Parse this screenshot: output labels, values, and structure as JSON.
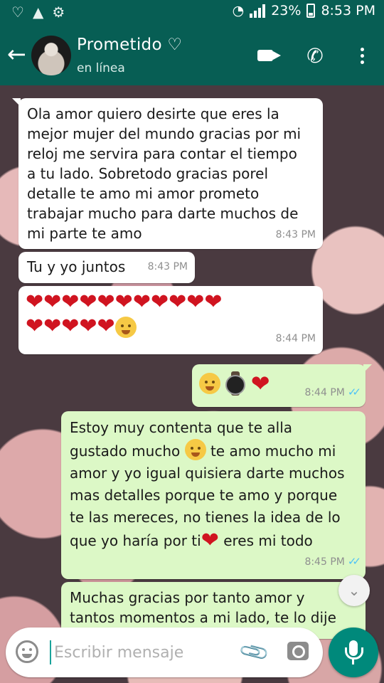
{
  "status_bar": {
    "battery": "23%",
    "time": "8:53 PM"
  },
  "header": {
    "contact_name": "Prometido ♡",
    "contact_status": "en línea"
  },
  "messages": [
    {
      "direction": "incoming",
      "text": "Ola amor quiero desirte que eres la\nmejor mujer del mundo gracias por mi\nreloj me servira para contar el tiempo\na tu lado. Sobretodo gracias porel\ndetalle te amo mi amor prometo\ntrabajar mucho para darte muchos de\nmi parte te amo",
      "time": "8:43 PM"
    },
    {
      "direction": "incoming",
      "text": "Tu y yo juntos",
      "time": "8:43 PM"
    },
    {
      "direction": "incoming",
      "text": "",
      "time": "8:44 PM",
      "emoji": [
        "red-heart x16",
        "kissing-face"
      ]
    },
    {
      "direction": "outgoing",
      "text": "",
      "time": "8:44 PM",
      "emoji": [
        "hugging-face",
        "watch",
        "red-heart"
      ],
      "read": true
    },
    {
      "direction": "outgoing",
      "text_parts": [
        "Estoy muy contenta que te alla\ngustado mucho ",
        " te amo mucho mi\namor y yo igual quisiera darte muchos\nmas detalles porque te amo y porque\nte las mereces, no tienes la idea de lo\nque yo haría por ti",
        " eres mi todo"
      ],
      "time": "8:45 PM",
      "read": true
    },
    {
      "direction": "outgoing",
      "text": "Muchas gracias por tanto amor y\ntantos momentos a mi lado, te lo dije"
    }
  ],
  "composer": {
    "placeholder": "Escribir mensaje"
  },
  "icons": {
    "status_left": [
      "heart-outline-icon",
      "drive-icon",
      "settings-icon"
    ],
    "status_right": [
      "wifi-icon",
      "signal-icon",
      "battery-icon"
    ],
    "appbar": [
      "back-arrow-icon",
      "video-call-icon",
      "phone-icon",
      "more-options-icon"
    ],
    "composer": [
      "emoji-icon",
      "attach-icon",
      "camera-icon",
      "mic-icon"
    ]
  },
  "colors": {
    "header": "#075e54",
    "incoming_bubble": "#ffffff",
    "outgoing_bubble": "#dcf8c6",
    "read_ticks": "#4fc3f7",
    "mic_button": "#00897b"
  }
}
